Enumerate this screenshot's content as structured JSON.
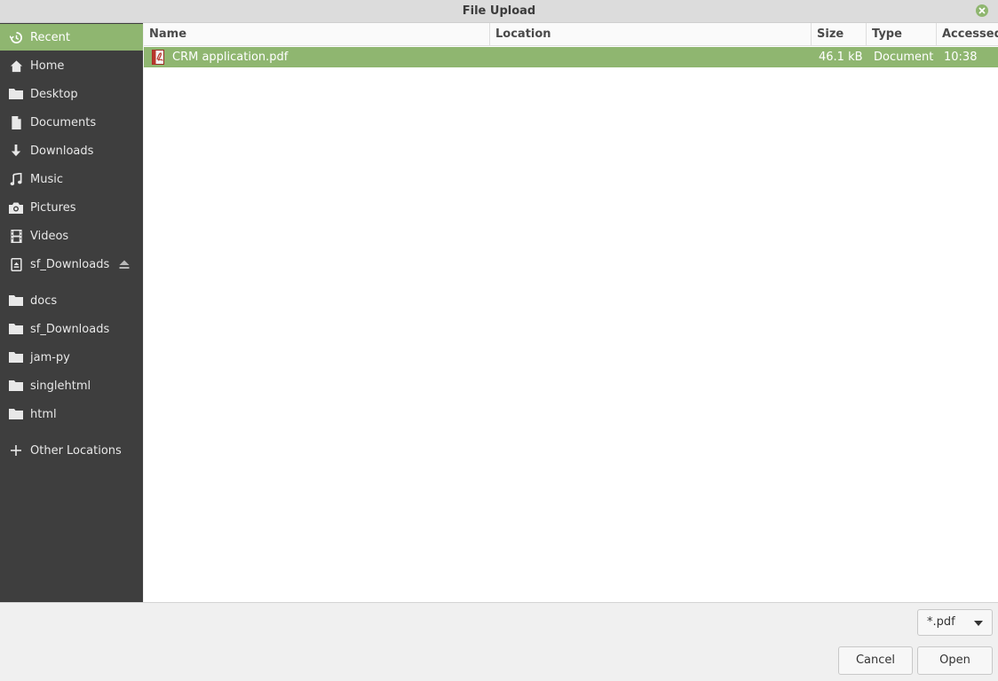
{
  "window": {
    "title": "File Upload"
  },
  "sidebar": {
    "items": [
      {
        "label": "Recent",
        "icon": "recent-icon",
        "active": true
      },
      {
        "label": "Home",
        "icon": "home-icon"
      },
      {
        "label": "Desktop",
        "icon": "folder-icon"
      },
      {
        "label": "Documents",
        "icon": "document-icon"
      },
      {
        "label": "Downloads",
        "icon": "download-icon"
      },
      {
        "label": "Music",
        "icon": "music-icon"
      },
      {
        "label": "Pictures",
        "icon": "camera-icon"
      },
      {
        "label": "Videos",
        "icon": "film-icon"
      },
      {
        "label": "sf_Downloads",
        "icon": "drive-icon",
        "eject": true
      },
      {
        "label": "docs",
        "icon": "folder-icon"
      },
      {
        "label": "sf_Downloads",
        "icon": "folder-icon"
      },
      {
        "label": "jam-py",
        "icon": "folder-icon"
      },
      {
        "label": "singlehtml",
        "icon": "folder-icon"
      },
      {
        "label": "html",
        "icon": "folder-icon"
      },
      {
        "label": "Other Locations",
        "icon": "plus-icon"
      }
    ]
  },
  "files": {
    "columns": [
      "Name",
      "Location",
      "Size",
      "Type",
      "Accessed"
    ],
    "rows": [
      {
        "name": "CRM application.pdf",
        "location": "",
        "size": "46.1 kB",
        "type": "Document",
        "accessed": "10:38",
        "icon": "pdf-icon",
        "selected": true
      }
    ]
  },
  "filter": {
    "selected": "*.pdf"
  },
  "buttons": {
    "cancel": "Cancel",
    "open": "Open"
  },
  "colors": {
    "accent": "#8fb670",
    "sidebar_bg": "#3e3e3e"
  }
}
